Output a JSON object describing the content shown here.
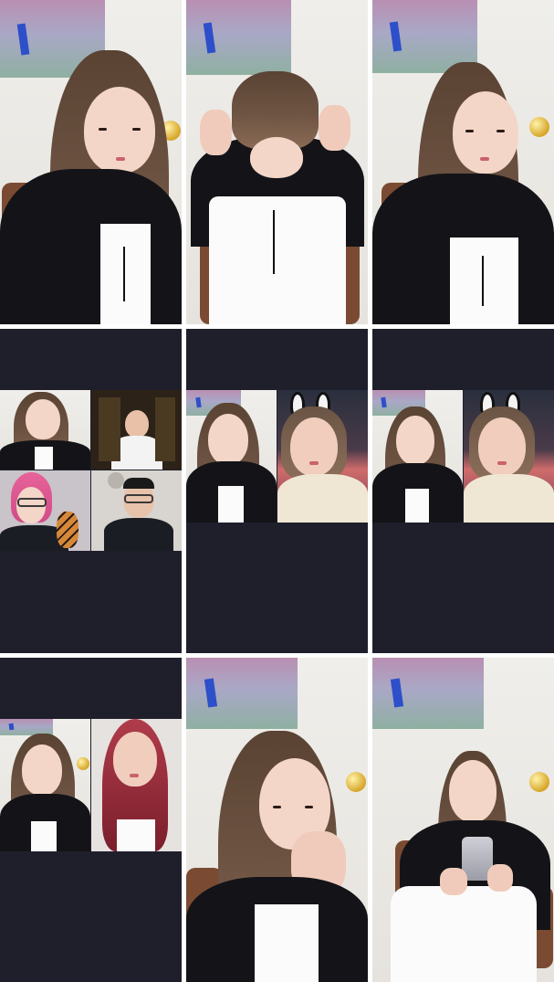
{
  "screen": {
    "type": "live-stream multi-room grid",
    "cells": [
      {
        "layout": "single-camera",
        "scene": "studio",
        "pose": "seated-looking-down"
      },
      {
        "layout": "single-camera",
        "scene": "studio",
        "pose": "arranging-hair"
      },
      {
        "layout": "single-camera",
        "scene": "studio",
        "pose": "seated-glancing-right"
      },
      {
        "layout": "four-way-link",
        "guests": [
          "host",
          "man-in-white-shirt",
          "pink-haired-woman-glasses",
          "man-in-dark-shirt-glasses"
        ]
      },
      {
        "layout": "two-way-link",
        "guests": [
          "host",
          "woman-with-bunny-ear-headband-night-street"
        ]
      },
      {
        "layout": "two-way-link",
        "guests": [
          "host",
          "woman-with-bunny-ear-headband-night-street"
        ]
      },
      {
        "layout": "two-way-link",
        "guests": [
          "host-eyes-closed",
          "red-haired-woman"
        ]
      },
      {
        "layout": "single-camera",
        "scene": "studio-closeup",
        "pose": "hand-on-chin"
      },
      {
        "layout": "single-camera",
        "scene": "studio",
        "pose": "holding-phone"
      }
    ]
  },
  "colors": {
    "background": "#1f1f2c",
    "separator": "#ffffff"
  }
}
